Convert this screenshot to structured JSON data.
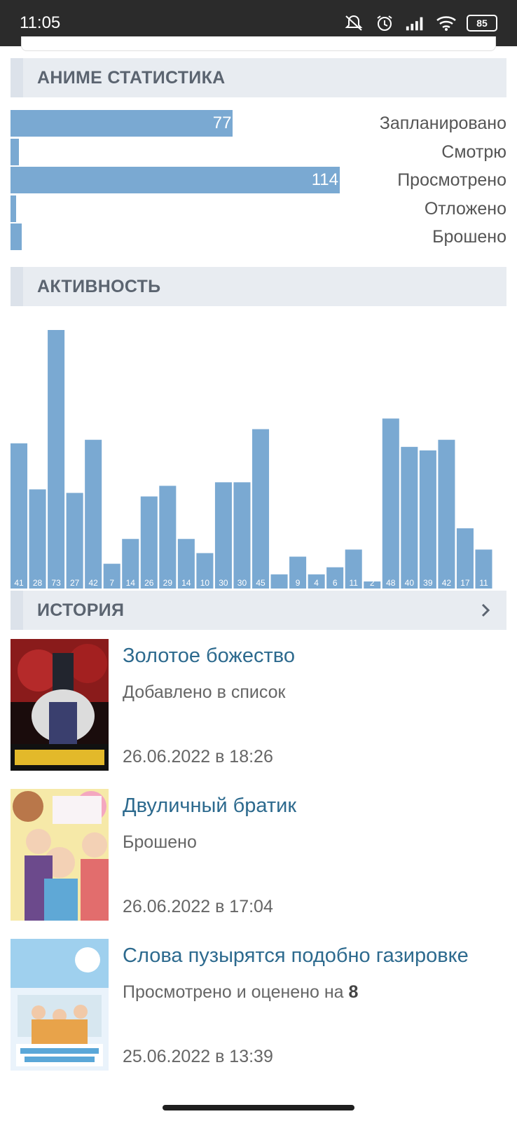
{
  "statusbar": {
    "time": "11:05",
    "battery": "85",
    "icons": [
      "mute-icon",
      "alarm-icon",
      "signal-icon",
      "wifi-icon",
      "battery-icon"
    ]
  },
  "anime_stats": {
    "title": "АНИМЕ СТАТИСТИКА",
    "rows": [
      {
        "label": "Запланировано",
        "value": 77,
        "value_label": "77"
      },
      {
        "label": "Смотрю",
        "value": 3,
        "value_label": ""
      },
      {
        "label": "Просмотрено",
        "value": 114,
        "value_label": "114"
      },
      {
        "label": "Отложено",
        "value": 2,
        "value_label": ""
      },
      {
        "label": "Брошено",
        "value": 4,
        "value_label": ""
      }
    ]
  },
  "activity": {
    "title": "АКТИВНОСТЬ",
    "bar_color": "#7aa9d2"
  },
  "chart_data": {
    "type": "bar",
    "values": [
      41,
      28,
      73,
      27,
      42,
      7,
      14,
      26,
      29,
      14,
      10,
      30,
      30,
      45,
      4,
      9,
      4,
      6,
      11,
      2,
      48,
      40,
      39,
      42,
      17,
      11
    ],
    "data_labels": [
      "41",
      "28",
      "73",
      "27",
      "42",
      "7",
      "14",
      "26",
      "29",
      "14",
      "10",
      "30",
      "30",
      "45",
      "",
      "9",
      "4",
      "6",
      "11",
      "2",
      "48",
      "40",
      "39",
      "42",
      "17",
      "11"
    ],
    "ylim": [
      0,
      73
    ]
  },
  "history": {
    "title": "ИСТОРИЯ",
    "items": [
      {
        "title": "Золотое божество",
        "status": "Добавлено в список",
        "score": "",
        "date": "26.06.2022 в 18:26"
      },
      {
        "title": "Двуличный братик",
        "status": "Брошено",
        "score": "",
        "date": "26.06.2022 в 17:04"
      },
      {
        "title": "Слова пузырятся подобно газировке",
        "status": "Просмотрено и оценено на ",
        "score": "8",
        "date": "25.06.2022 в 13:39"
      }
    ]
  },
  "colors": {
    "accent": "#7aa9d2",
    "link": "#2d6a8e",
    "header_bg": "#e8ecf1"
  }
}
